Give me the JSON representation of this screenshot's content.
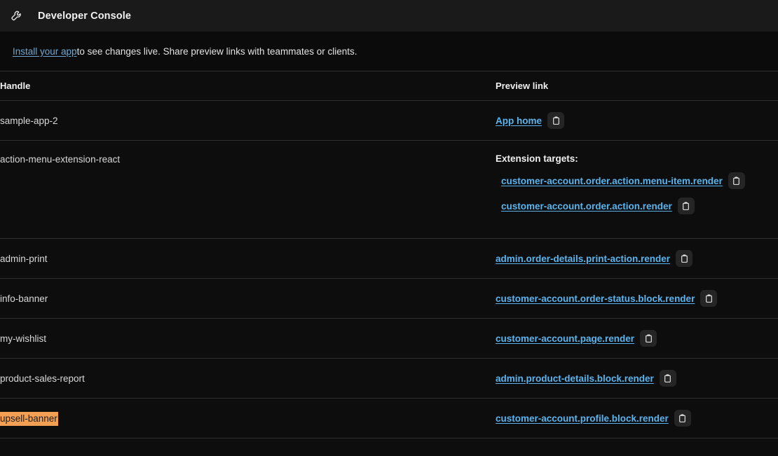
{
  "window": {
    "icon": "wrench-icon",
    "title": "Developer Console"
  },
  "banner": {
    "link_text": "Install your app",
    "rest_text": " to see changes live. Share preview links with teammates or clients."
  },
  "table": {
    "columns": {
      "handle": "Handle",
      "preview_link": "Preview link"
    },
    "copy_icon": "clipboard-icon",
    "extension_targets_label": "Extension targets:",
    "rows": [
      {
        "handle": "sample-app-2",
        "highlighted": false,
        "links": [
          "App home"
        ]
      },
      {
        "handle": "action-menu-extension-react",
        "highlighted": false,
        "has_targets_label": true,
        "links": [
          "customer-account.order.action.menu-item.render",
          "customer-account.order.action.render"
        ]
      },
      {
        "handle": "admin-print",
        "highlighted": false,
        "links": [
          "admin.order-details.print-action.render"
        ]
      },
      {
        "handle": "info-banner",
        "highlighted": false,
        "links": [
          "customer-account.order-status.block.render"
        ]
      },
      {
        "handle": "my-wishlist",
        "highlighted": false,
        "links": [
          "customer-account.page.render"
        ]
      },
      {
        "handle": "product-sales-report",
        "highlighted": false,
        "links": [
          "admin.product-details.block.render"
        ]
      },
      {
        "handle": "upsell-banner",
        "highlighted": true,
        "links": [
          "customer-account.profile.block.render"
        ]
      }
    ]
  },
  "colors": {
    "page_background": "#0b0b0b",
    "topbar_background": "#1a1a1a",
    "row_background": "#0d0d0d",
    "divider": "#2e2e2e",
    "link": "#5cb4ef",
    "banner_link": "#6fa8d4",
    "highlight": "#f3a055",
    "copy_button_background": "#252525"
  }
}
